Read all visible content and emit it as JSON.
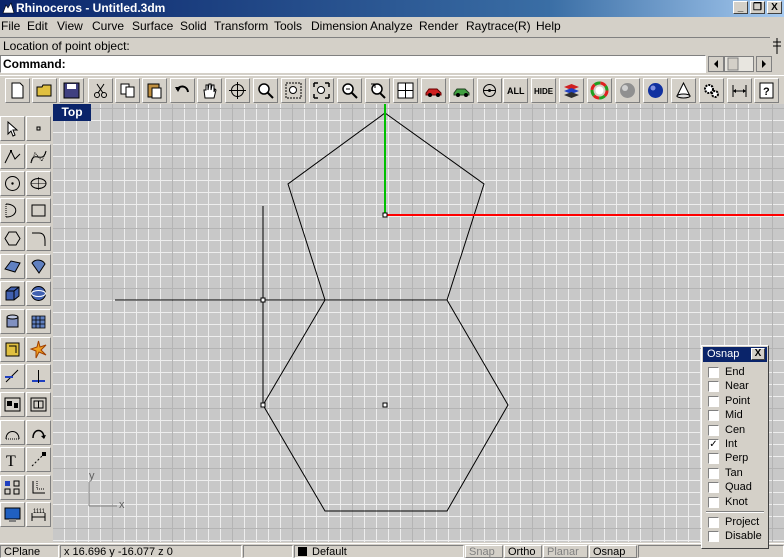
{
  "window": {
    "title": "Rhinoceros - Untitled.3dm",
    "minimize_label": "_",
    "restore_label": "❐",
    "close_label": "X"
  },
  "menu": [
    "File",
    "Edit",
    "View",
    "Curve",
    "Surface",
    "Solid",
    "Transform",
    "Tools",
    "Dimension",
    "Analyze",
    "Render",
    "Raytrace(R)",
    "Help"
  ],
  "command_area": {
    "history_text": "Location of point object:",
    "prompt_label": "Command:",
    "input_value": ""
  },
  "viewport": {
    "title": "Top",
    "axis_x_label": "x",
    "axis_y_label": "y"
  },
  "osnap_panel": {
    "title": "Osnap",
    "close_label": "X",
    "options": [
      {
        "label": "End",
        "checked": false
      },
      {
        "label": "Near",
        "checked": false
      },
      {
        "label": "Point",
        "checked": false
      },
      {
        "label": "Mid",
        "checked": false
      },
      {
        "label": "Cen",
        "checked": false
      },
      {
        "label": "Int",
        "checked": true
      },
      {
        "label": "Perp",
        "checked": false
      },
      {
        "label": "Tan",
        "checked": false
      },
      {
        "label": "Quad",
        "checked": false
      },
      {
        "label": "Knot",
        "checked": false
      }
    ],
    "extra_options": [
      {
        "label": "Project",
        "checked": false
      },
      {
        "label": "Disable",
        "checked": false
      }
    ]
  },
  "statusbar": {
    "cplane_label": "CPlane",
    "coordinates": "x 16.696  y -16.077  z 0",
    "layer": "Default",
    "snap": "Snap",
    "ortho": "Ortho",
    "planar": "Planar",
    "osnap": "Osnap"
  },
  "colors": {
    "title_gradient_start": "#0a246a",
    "x_axis": "#ff0000",
    "y_axis": "#00c000",
    "viewport_bg": "#c8c8c8"
  }
}
